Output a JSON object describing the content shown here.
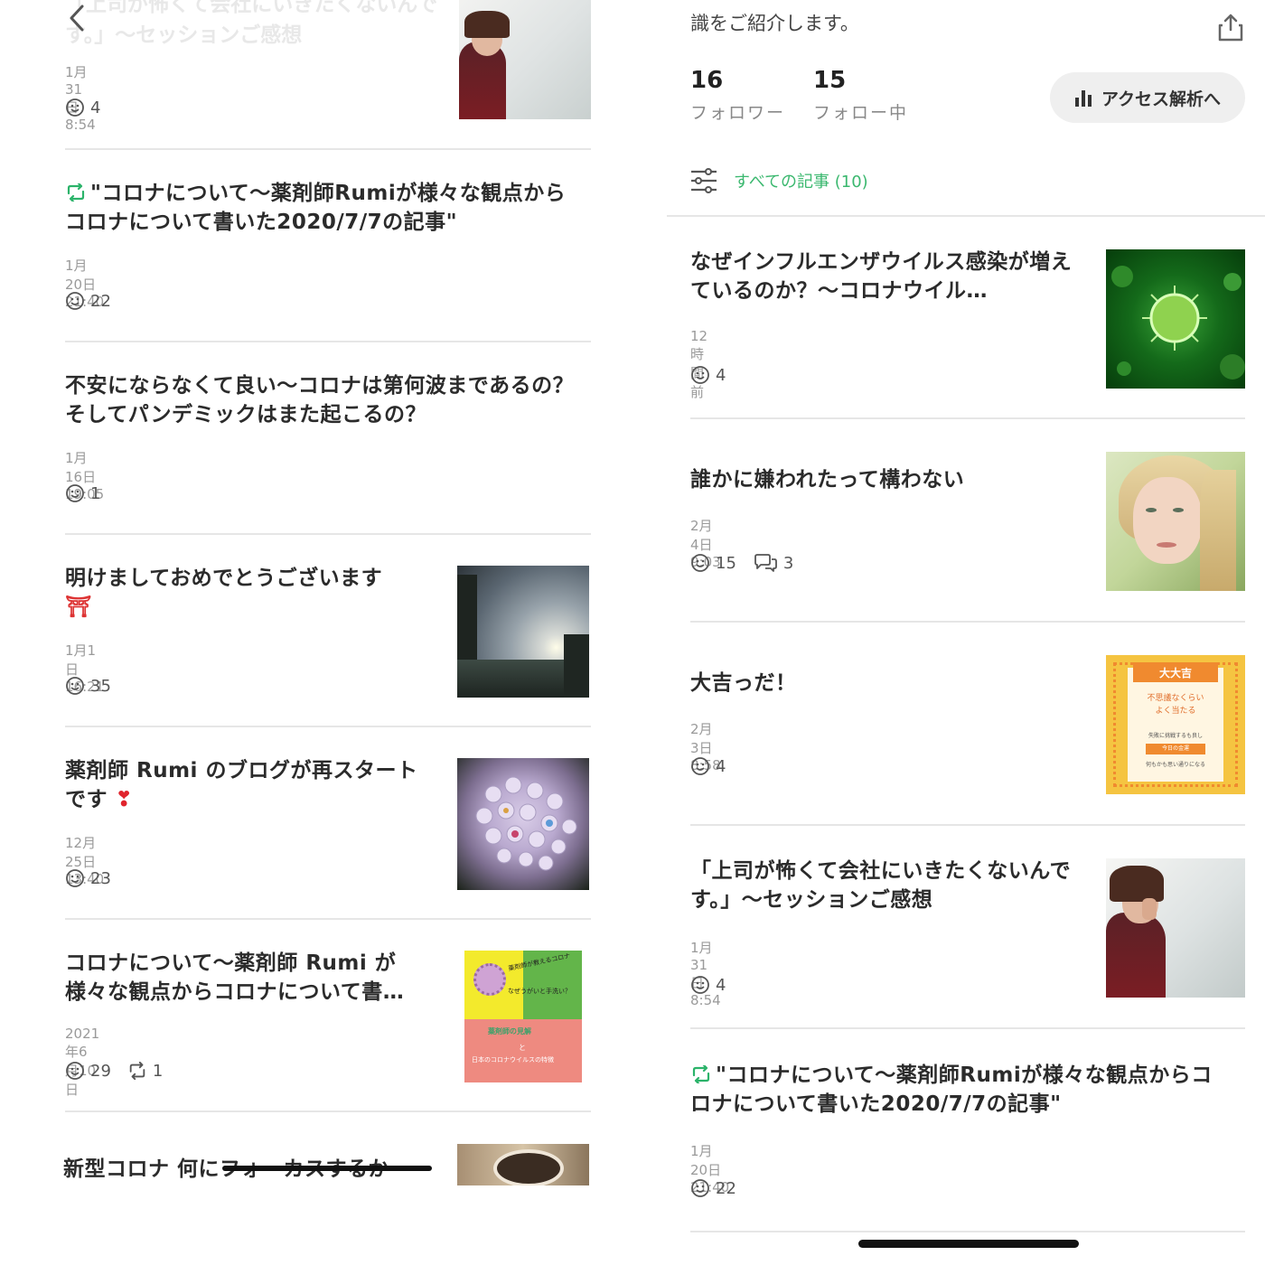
{
  "left": {
    "faded_title": "「上司が怖くて会社にいきたくないんです。」〜セッションご感想",
    "articles": [
      {
        "date": "1月31日 8:54",
        "likes": "4"
      },
      {
        "title": "\"コロナについて〜薬剤師Rumiが様々な観点からコロナについて書いた2020/7/7の記事\"",
        "date": "1月20日 21:40",
        "likes": "22"
      },
      {
        "title": "不安にならなくて良い〜コロナは第何波まであるの？そしてパンデミックはまた起こるの？",
        "date": "1月16日 19:05",
        "likes": "1"
      },
      {
        "title": "明けましておめでとうございます",
        "emoji": "⛩",
        "date": "1月1日 16:21",
        "likes": "35"
      },
      {
        "title": "薬剤師 Rumi のブログが再スタートです",
        "emoji": "❣",
        "date": "12月25日 13:40",
        "likes": "23"
      },
      {
        "title": "コロナについて〜薬剤師 Rumi が様々な観点からコロナについて書…",
        "date": "2021年6月10日",
        "likes": "29",
        "reposts": "1",
        "thumb_text": {
          "line1": "薬剤師が教えるコロナ",
          "line2": "なぜうがいと手洗い？",
          "line3": "薬剤師の見解",
          "line4": "と",
          "line5": "日本のコロナウイルスの特徴"
        }
      },
      {
        "title": "新型コロナ 何にフォーカスするか"
      }
    ]
  },
  "right": {
    "intro_snippet": "識をご紹介します。",
    "followers": {
      "count": "16",
      "label": "フォロワー"
    },
    "following": {
      "count": "15",
      "label": "フォロー中"
    },
    "access_button": "アクセス解析へ",
    "filter_label": "すべての記事 (10)",
    "articles": [
      {
        "title": "なぜインフルエンザウイルス感染が増えているのか？〜コロナウイル…",
        "date": "12時間前",
        "likes": "4"
      },
      {
        "title": "誰かに嫌われたって構わない",
        "date": "2月4日 9:03",
        "likes": "15",
        "comments": "3"
      },
      {
        "title": "大吉っだ！",
        "date": "2月3日 8:58",
        "likes": "4",
        "thumb_text": {
          "header": "大大吉",
          "line1": "不思議なくらい",
          "line2": "よく当たる",
          "line3": "失敗に挑戦するも良し",
          "line4": "今日の金運",
          "line5": "何もかも思い通りになる"
        }
      },
      {
        "title": "「上司が怖くて会社にいきたくないんです。」〜セッションご感想",
        "date": "1月31日 8:54",
        "likes": "4"
      },
      {
        "title": "\"コロナについて〜薬剤師Rumiが様々な観点からコロナについて書いた2020/7/7の記事\"",
        "date": "1月20日 21:40",
        "likes": "22"
      }
    ]
  }
}
